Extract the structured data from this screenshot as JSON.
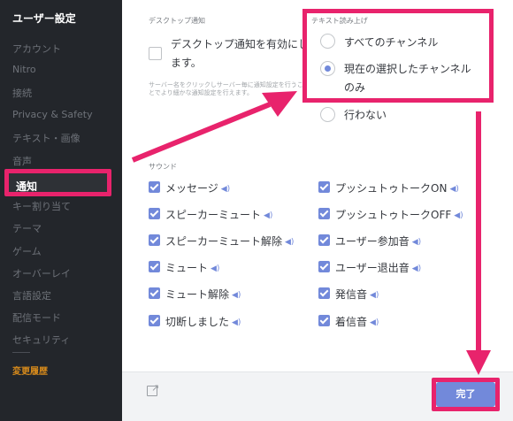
{
  "sidebar": {
    "title": "ユーザー設定",
    "items": [
      {
        "label": "アカウント"
      },
      {
        "label": "Nitro"
      },
      {
        "label": "接続"
      },
      {
        "label": "Privacy & Safety"
      },
      {
        "label": "テキスト・画像"
      },
      {
        "label": "音声"
      },
      {
        "label": "通知"
      },
      {
        "label": "キー割り当て"
      },
      {
        "label": "テーマ"
      },
      {
        "label": "ゲーム"
      },
      {
        "label": "オーバーレイ"
      },
      {
        "label": "言語設定"
      },
      {
        "label": "配信モード"
      },
      {
        "label": "セキュリティ"
      }
    ],
    "changelog": "変更履歴",
    "active_color": "#ffffff",
    "changelog_color": "#d68a1c"
  },
  "desktop": {
    "section_label": "デスクトップ通知",
    "checkbox_label": "デスクトップ通知を有効にします。",
    "checked": false,
    "help_text": "サーバー名をクリックしサーバー毎に通知設定を行うことでより細かな通知設定を行えます。"
  },
  "tts": {
    "section_label": "テキスト読み上げ",
    "options": [
      {
        "label": "すべてのチャンネル",
        "selected": false
      },
      {
        "label": "現在の選択したチャンネルのみ",
        "selected": true
      },
      {
        "label": "行わない",
        "selected": false
      }
    ]
  },
  "sounds": {
    "section_label": "サウンド",
    "left": [
      {
        "label": "メッセージ",
        "checked": true
      },
      {
        "label": "スピーカーミュート",
        "checked": true
      },
      {
        "label": "スピーカーミュート解除",
        "checked": true
      },
      {
        "label": "ミュート",
        "checked": true
      },
      {
        "label": "ミュート解除",
        "checked": true
      },
      {
        "label": "切断しました",
        "checked": true
      }
    ],
    "right": [
      {
        "label": "プッシュトゥトークON",
        "checked": true
      },
      {
        "label": "プッシュトゥトークOFF",
        "checked": true
      },
      {
        "label": "ユーザー参加音",
        "checked": true
      },
      {
        "label": "ユーザー退出音",
        "checked": true
      },
      {
        "label": "発信音",
        "checked": true
      },
      {
        "label": "着信音",
        "checked": true
      }
    ],
    "speaker_icon": "speaker-icon"
  },
  "footer": {
    "done_label": "完了",
    "popout_icon": "popout-icon"
  },
  "colors": {
    "accent": "#7289da",
    "highlight": "#e8236c"
  }
}
